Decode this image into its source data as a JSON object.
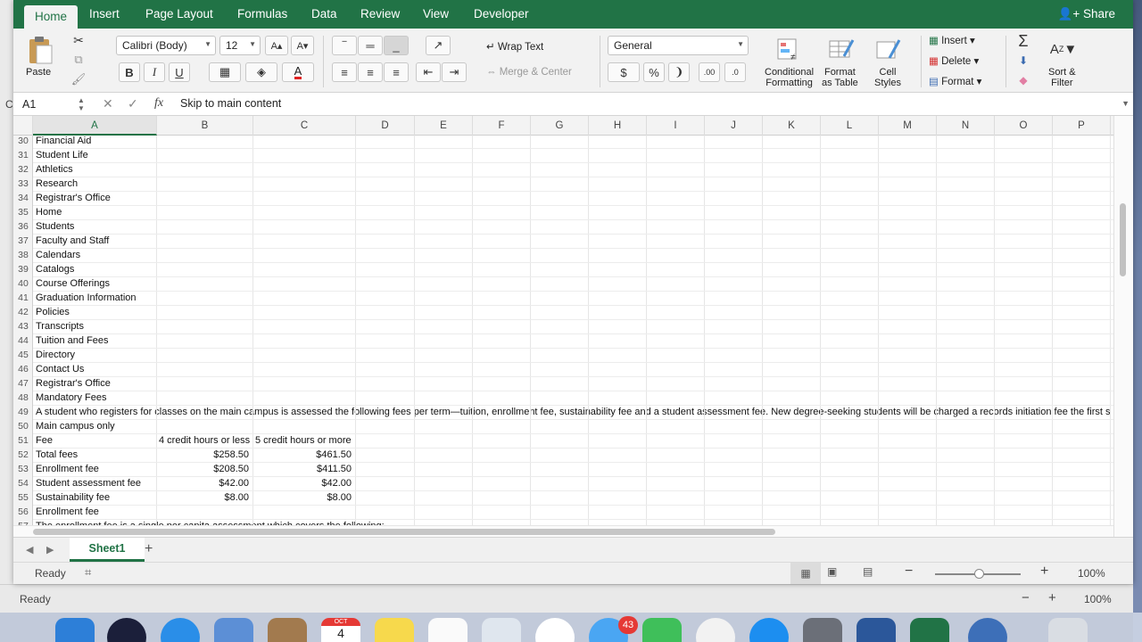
{
  "app": {
    "tabs": [
      "Home",
      "Insert",
      "Page Layout",
      "Formulas",
      "Data",
      "Review",
      "View",
      "Developer"
    ],
    "active_tab": "Home",
    "share_label": "Share"
  },
  "ribbon": {
    "paste_label": "Paste",
    "font_name": "Calibri (Body)",
    "font_size": "12",
    "bold": "B",
    "italic": "I",
    "underline": "U",
    "wrap_text": "Wrap Text",
    "merge_center": "Merge & Center",
    "number_format": "General",
    "currency": "$",
    "percent": "%",
    "comma": "❩",
    "conditional_formatting": [
      "Conditional",
      "Formatting"
    ],
    "format_as_table": [
      "Format",
      "as Table"
    ],
    "cell_styles": [
      "Cell",
      "Styles"
    ],
    "insert": "Insert",
    "delete": "Delete",
    "format": "Format",
    "sort_filter": [
      "Sort &",
      "Filter"
    ],
    "font_color": "#e02020",
    "accent": "#217346"
  },
  "formula_bar": {
    "cell_ref": "A1",
    "fx": "fx",
    "content": "Skip to main content"
  },
  "grid": {
    "columns": [
      "A",
      "B",
      "C",
      "D",
      "E",
      "F",
      "G",
      "H",
      "I",
      "J",
      "K",
      "L",
      "M",
      "N",
      "O",
      "P"
    ],
    "selected_column": "A",
    "rows": [
      {
        "outer": "21",
        "n": "30",
        "a": "Financial Aid",
        "b": "",
        "c": ""
      },
      {
        "outer": "22",
        "n": "31",
        "a": "Student Life",
        "b": "",
        "c": ""
      },
      {
        "outer": "23",
        "n": "32",
        "a": "Athletics",
        "b": "",
        "c": ""
      },
      {
        "outer": "24",
        "n": "33",
        "a": "Research",
        "b": "",
        "c": ""
      },
      {
        "outer": "25",
        "n": "34",
        "a": "Registrar's Office",
        "b": "",
        "c": ""
      },
      {
        "outer": "26",
        "n": "35",
        "a": "Home",
        "b": "",
        "c": ""
      },
      {
        "outer": "27",
        "n": "36",
        "a": "Students",
        "b": "",
        "c": ""
      },
      {
        "outer": "28",
        "n": "37",
        "a": "Faculty and Staff",
        "b": "",
        "c": ""
      },
      {
        "outer": "29",
        "n": "38",
        "a": "Calendars",
        "b": "",
        "c": ""
      },
      {
        "outer": "30",
        "n": "39",
        "a": "Catalogs",
        "b": "",
        "c": ""
      },
      {
        "outer": "31",
        "n": "40",
        "a": "Course Offerings",
        "b": "",
        "c": ""
      },
      {
        "outer": "32",
        "n": "41",
        "a": "Graduation Information",
        "b": "",
        "c": ""
      },
      {
        "outer": "33",
        "n": "42",
        "a": "Policies",
        "b": "",
        "c": ""
      },
      {
        "outer": "34",
        "n": "43",
        "a": "Transcripts",
        "b": "",
        "c": ""
      },
      {
        "outer": "35",
        "n": "44",
        "a": "Tuition and Fees",
        "b": "",
        "c": ""
      },
      {
        "outer": "36",
        "n": "45",
        "a": "Directory",
        "b": "",
        "c": ""
      },
      {
        "outer": "37",
        "n": "46",
        "a": "Contact Us",
        "b": "",
        "c": ""
      },
      {
        "outer": "38",
        "n": "47",
        "a": "Registrar's Office",
        "b": "",
        "c": ""
      },
      {
        "outer": "39",
        "n": "48",
        "a": "Mandatory Fees",
        "b": "",
        "c": ""
      },
      {
        "outer": "40",
        "n": "49",
        "a": "A student who registers for classes on the main campus is assessed the following fees per term—tuition, enrollment fee, sustainability fee and a student assessment fee. New degree-seeking students will be charged a records initiation fee the first s",
        "b": "",
        "c": ""
      },
      {
        "outer": "41",
        "n": "50",
        "a": "Main campus only",
        "b": "",
        "c": ""
      },
      {
        "outer": "42",
        "n": "51",
        "a": "Fee",
        "b": "4 credit hours or less",
        "c": "5 credit hours or more",
        "text": true
      },
      {
        "outer": "43",
        "n": "52",
        "a": "Total fees",
        "b": "$258.50",
        "c": "$461.50"
      },
      {
        "outer": "44",
        "n": "53",
        "a": "Enrollment fee",
        "b": "$208.50",
        "c": "$411.50"
      },
      {
        "outer": "45",
        "n": "54",
        "a": "Student assessment fee",
        "b": "$42.00",
        "c": "$42.00"
      },
      {
        "outer": "46",
        "n": "55",
        "a": "Sustainability fee",
        "b": "$8.00",
        "c": "$8.00"
      },
      {
        "outer": "47",
        "n": "56",
        "a": "Enrollment fee",
        "b": "",
        "c": ""
      },
      {
        "outer": "48",
        "n": "57",
        "a": "The enrollment fee is a single per capita assessment which covers the following:",
        "b": "",
        "c": ""
      }
    ],
    "outer_tail": [
      "49",
      "50",
      "51"
    ]
  },
  "sheets": {
    "tabs": [
      "Sheet1"
    ],
    "add": "+"
  },
  "status": {
    "ready": "Ready",
    "zoom": "100%",
    "zoom_minus": "−",
    "zoom_plus": "+"
  },
  "background_window": {
    "ready": "Ready",
    "zoom": "100%",
    "zoom_minus": "−",
    "zoom_plus": "+",
    "formula_cell": "C"
  },
  "dock": {
    "calendar_month": "OCT",
    "calendar_day": "4",
    "badge_count": "43"
  }
}
